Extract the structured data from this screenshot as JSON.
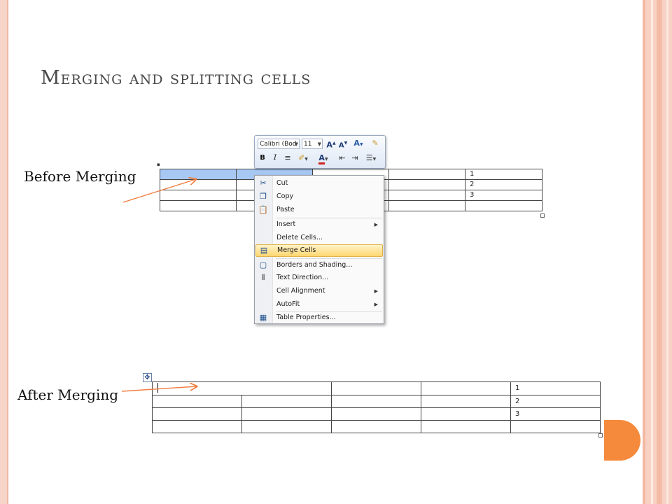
{
  "slide": {
    "title": "Merging and splitting cells",
    "before_label": "Before Merging",
    "after_label": "After Merging"
  },
  "colors": {
    "selection": "#a8c8f4",
    "arrow": "#f07d3c",
    "menu_highlight": "#ffd770",
    "accent_orange": "#f68a3c",
    "frame": "#f6d4c8"
  },
  "before_table": {
    "rows": [
      [
        "",
        "",
        "",
        "",
        "1"
      ],
      [
        "",
        "",
        "",
        "",
        "2"
      ],
      [
        "",
        "",
        "",
        "",
        "3"
      ],
      [
        "",
        "",
        "",
        "",
        ""
      ]
    ]
  },
  "after_table": {
    "rows": [
      [
        "",
        "",
        "1"
      ],
      [
        "",
        "",
        "",
        "",
        "2"
      ],
      [
        "",
        "",
        "",
        "",
        "3"
      ],
      [
        "",
        "",
        "",
        "",
        ""
      ]
    ]
  },
  "mini_toolbar": {
    "font_name": "Calibri (Bod",
    "font_size": "11",
    "icons": [
      "grow-font-icon",
      "shrink-font-icon",
      "styles-icon",
      "format-painter-icon",
      "bold-icon",
      "italic-icon",
      "center-icon",
      "highlight-icon",
      "font-color-icon",
      "decrease-indent-icon",
      "increase-indent-icon",
      "bullets-icon"
    ],
    "bold": "B",
    "italic": "I"
  },
  "context_menu": {
    "items": [
      {
        "label": "Cut",
        "icon": "scissors-icon"
      },
      {
        "label": "Copy",
        "icon": "copy-icon"
      },
      {
        "label": "Paste",
        "icon": "paste-icon"
      },
      {
        "label": "Insert",
        "submenu": true
      },
      {
        "label": "Delete Cells...",
        "submenu": false
      },
      {
        "label": "Merge Cells",
        "icon": "merge-cells-icon",
        "highlighted": true
      },
      {
        "label": "Borders and Shading...",
        "icon": "borders-icon"
      },
      {
        "label": "Text Direction...",
        "icon": "text-direction-icon"
      },
      {
        "label": "Cell Alignment",
        "submenu": true
      },
      {
        "label": "AutoFit",
        "submenu": true
      },
      {
        "label": "Table Properties...",
        "icon": "table-properties-icon"
      }
    ]
  }
}
